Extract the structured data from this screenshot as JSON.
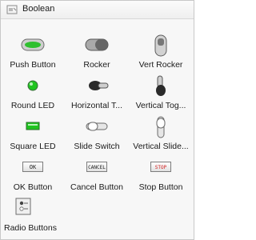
{
  "header": {
    "title": "Boolean",
    "icon": "boolean-palette-icon"
  },
  "controls": [
    {
      "label": "Push Button",
      "icon": "push-button-icon"
    },
    {
      "label": "Rocker",
      "icon": "rocker-switch-icon"
    },
    {
      "label": "Vert Rocker",
      "icon": "vertical-rocker-icon"
    },
    {
      "label": "Round LED",
      "icon": "round-led-icon"
    },
    {
      "label": "Horizontal T...",
      "icon": "horizontal-toggle-icon"
    },
    {
      "label": "Vertical Tog...",
      "icon": "vertical-toggle-icon"
    },
    {
      "label": "Square LED",
      "icon": "square-led-icon"
    },
    {
      "label": "Slide Switch",
      "icon": "slide-switch-icon"
    },
    {
      "label": "Vertical Slide...",
      "icon": "vertical-slide-icon"
    },
    {
      "label": "OK Button",
      "icon": "ok-button-icon",
      "text": "OK"
    },
    {
      "label": "Cancel Button",
      "icon": "cancel-button-icon",
      "text": "CANCEL"
    },
    {
      "label": "Stop Button",
      "icon": "stop-button-icon",
      "text": "STOP"
    },
    {
      "label": "Radio Buttons",
      "icon": "radio-buttons-icon"
    }
  ],
  "colors": {
    "led_green": "#1fc41f",
    "stop_red": "#d22020",
    "accent_blue": "#4a8fd6"
  }
}
